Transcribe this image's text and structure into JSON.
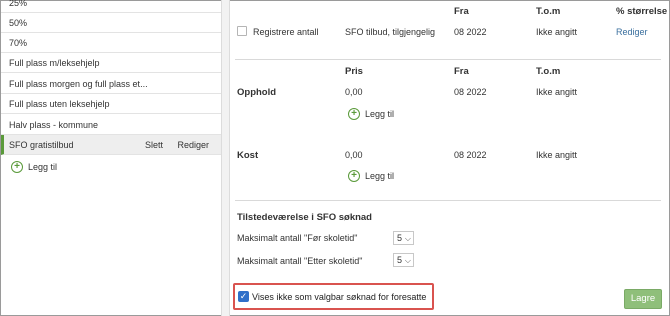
{
  "left_list": {
    "items": [
      {
        "label": "25%"
      },
      {
        "label": "50%"
      },
      {
        "label": "70%"
      },
      {
        "label": "Full plass m/leksehjelp"
      },
      {
        "label": "Full plass morgen og full plass et..."
      },
      {
        "label": "Full plass uten leksehjelp"
      },
      {
        "label": "Halv plass - kommune"
      },
      {
        "label": "SFO gratistilbud",
        "selected": true
      }
    ],
    "selected_actions": {
      "delete": "Slett",
      "edit": "Rediger"
    },
    "add_label": "Legg til"
  },
  "top_section": {
    "headers": {
      "from": "Fra",
      "to": "T.o.m",
      "size": "% størrelse"
    },
    "row": {
      "checkbox_label": "Registrere antall",
      "name": "SFO tilbud, tilgjengelig",
      "from": "08 2022",
      "to": "Ikke angitt",
      "edit": "Rediger"
    }
  },
  "pricing": {
    "headers": {
      "price": "Pris",
      "from": "Fra",
      "to": "T.o.m"
    },
    "opphold": {
      "label": "Opphold",
      "price": "0,00",
      "from": "08 2022",
      "to": "Ikke angitt",
      "add": "Legg til"
    },
    "kost": {
      "label": "Kost",
      "price": "0,00",
      "from": "08 2022",
      "to": "Ikke angitt",
      "add": "Legg til"
    }
  },
  "attendance": {
    "title": "Tilstedeværelse i SFO søknad",
    "before_label": "Maksimalt antall \"Før skoletid\"",
    "before_value": "5",
    "after_label": "Maksimalt antall \"Etter skoletid\"",
    "after_value": "5"
  },
  "footer": {
    "checkbox_label": "Vises ikke som valgbar søknad for foresatte",
    "checkbox_checked": true,
    "save_label": "Lagre"
  }
}
